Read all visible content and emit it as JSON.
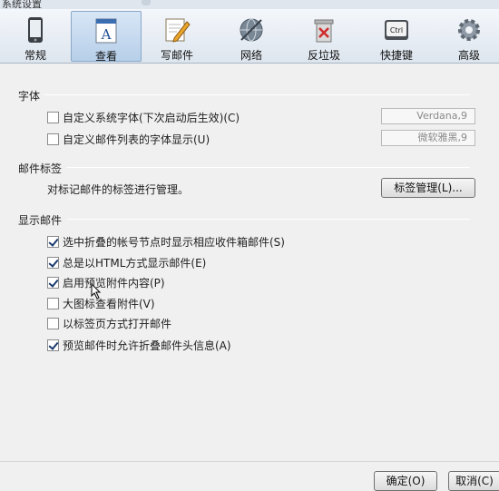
{
  "window": {
    "title": "系统设置"
  },
  "toolbar": {
    "items": [
      {
        "label": "常规",
        "icon": "phone-device-icon"
      },
      {
        "label": "查看",
        "icon": "document-view-icon"
      },
      {
        "label": "写邮件",
        "icon": "pencil-paper-icon"
      },
      {
        "label": "网络",
        "icon": "globe-network-icon"
      },
      {
        "label": "反垃圾",
        "icon": "trash-bin-icon"
      },
      {
        "label": "快捷键",
        "icon": "keyboard-ctrl-icon"
      },
      {
        "label": "高级",
        "icon": "gear-icon"
      }
    ],
    "active": "查看",
    "ctrl_key_text": "Ctrl"
  },
  "font_section": {
    "title": "字体",
    "options": [
      {
        "label": "自定义系统字体(下次启动后生效)(C)",
        "checked": false,
        "value": "Verdana,9"
      },
      {
        "label": "自定义邮件列表的字体显示(U)",
        "checked": false,
        "value": "微软雅黑,9"
      }
    ]
  },
  "tags_section": {
    "title": "邮件标签",
    "description": "对标记邮件的标签进行管理。",
    "button_label": "标签管理(L)..."
  },
  "display_section": {
    "title": "显示邮件",
    "options": [
      {
        "label": "选中折叠的帐号节点时显示相应收件箱邮件(S)",
        "checked": true
      },
      {
        "label": "总是以HTML方式显示邮件(E)",
        "checked": true
      },
      {
        "label": "启用预览附件内容(P)",
        "checked": true
      },
      {
        "label": "大图标查看附件(V)",
        "checked": false
      },
      {
        "label": "以标签页方式打开邮件",
        "checked": false
      },
      {
        "label": "预览邮件时允许折叠邮件头信息(A)",
        "checked": true
      }
    ]
  },
  "footer": {
    "ok_label": "确定(O)",
    "cancel_label": "取消(C)"
  },
  "colors": {
    "accent": "#b7cfe9",
    "check": "#1a3a6e"
  }
}
